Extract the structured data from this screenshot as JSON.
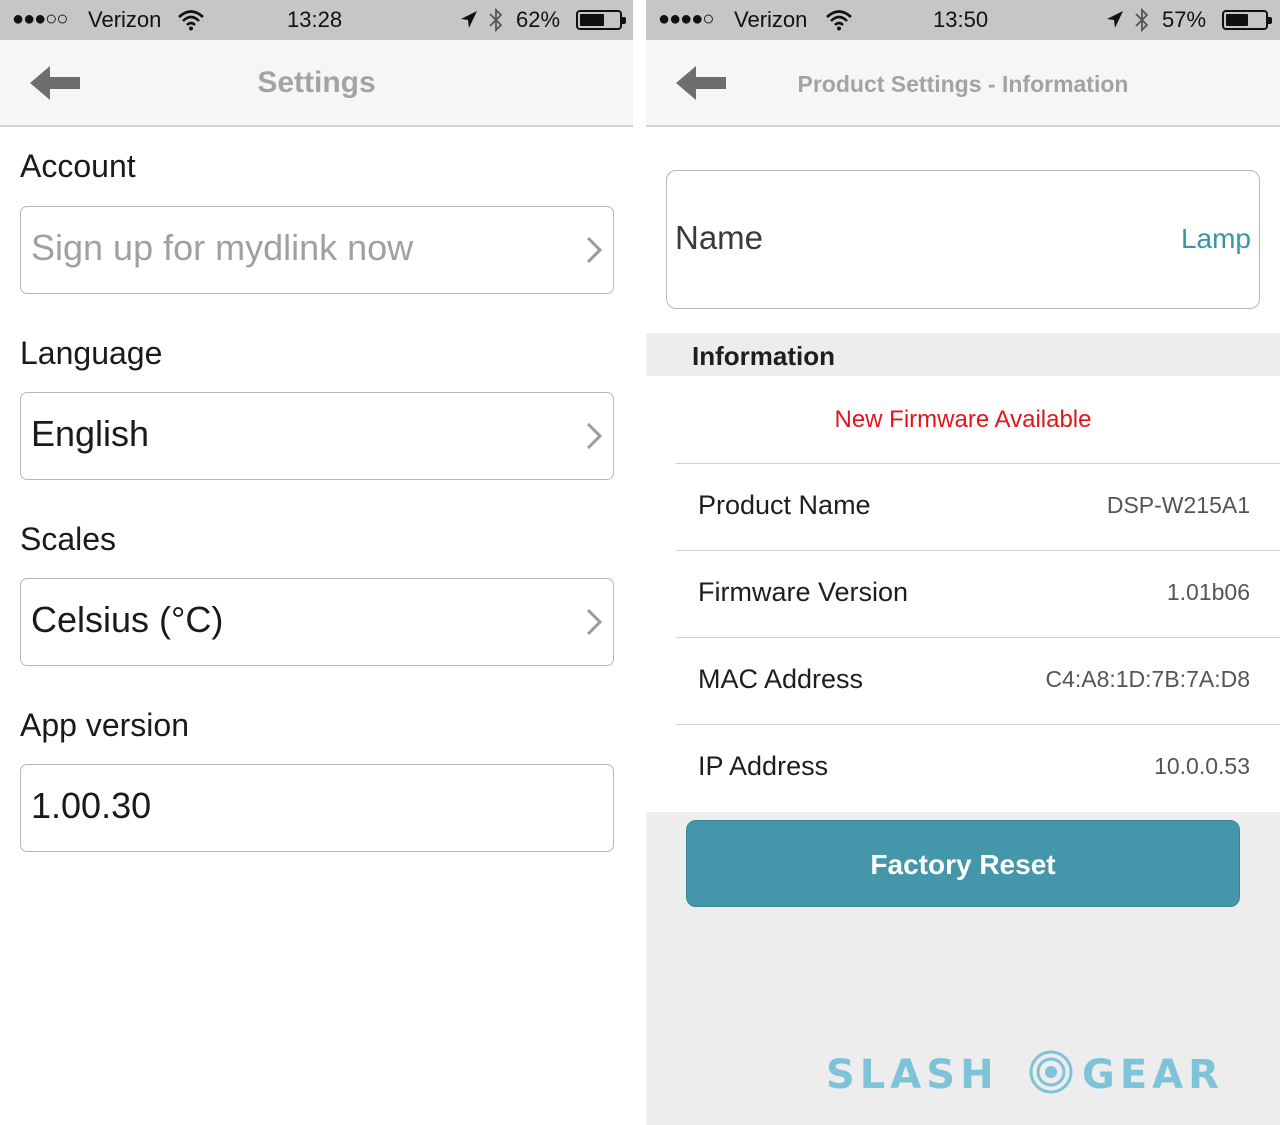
{
  "left": {
    "status": {
      "signal": "●●●○○",
      "carrier": "Verizon",
      "time": "13:28",
      "battery_text": "62%",
      "battery_level": 0.62
    },
    "nav": {
      "title": "Settings",
      "back_icon": "back-arrow-icon"
    },
    "sections": {
      "account": {
        "label": "Account",
        "placeholder": "Sign up for mydlink now"
      },
      "language": {
        "label": "Language",
        "value": "English"
      },
      "scales": {
        "label": "Scales",
        "value": "Celsius (°C)"
      },
      "app_version": {
        "label": "App version",
        "value": "1.00.30"
      }
    }
  },
  "right": {
    "status": {
      "signal": "●●●●○",
      "carrier": "Verizon",
      "time": "13:50",
      "battery_text": "57%",
      "battery_level": 0.57
    },
    "nav": {
      "title": "Product Settings - Information",
      "back_icon": "back-arrow-icon"
    },
    "name": {
      "label": "Name",
      "value": "Lamp"
    },
    "information": {
      "header": "Information",
      "alert": "New Firmware Available",
      "rows": [
        {
          "key": "Product Name",
          "value": "DSP-W215A1"
        },
        {
          "key": "Firmware Version",
          "value": "1.01b06"
        },
        {
          "key": "MAC Address",
          "value": "C4:A8:1D:7B:7A:D8"
        },
        {
          "key": "IP Address",
          "value": "10.0.0.53"
        }
      ]
    },
    "reset_button": "Factory Reset"
  },
  "watermark": {
    "left_text": "SLASH",
    "right_text": "GEAR"
  },
  "colors": {
    "accent": "#4497aa",
    "link": "#3a95a8",
    "alert": "#e0161c",
    "status_bar": "#c6c6c6",
    "watermark": "#7fc3d8"
  }
}
